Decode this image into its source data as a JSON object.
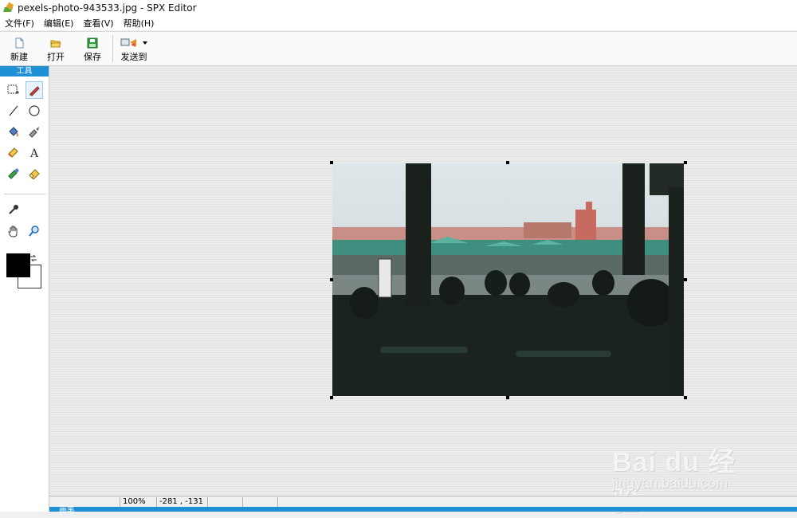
{
  "window": {
    "title": "pexels-photo-943533.jpg - SPX Editor"
  },
  "menu": {
    "items": [
      "文件(F)",
      "编辑(E)",
      "查看(V)",
      "帮助(H)"
    ]
  },
  "toolbar": {
    "new_label": "新建",
    "open_label": "打开",
    "save_label": "保存",
    "send_label": "发送到"
  },
  "palette": {
    "header": "工具",
    "tools": [
      "rect-select-icon",
      "pencil-icon",
      "line-icon",
      "ellipse-icon",
      "fill-bucket-icon",
      "brush-icon",
      "color-picker-icon",
      "text-icon",
      "highlighter-icon",
      "eraser-icon",
      "pipette-icon",
      "hand-icon",
      "zoom-icon"
    ],
    "foreground_color": "#000000",
    "background_color": "#ffffff"
  },
  "canvas": {
    "image_name": "pexels-photo-943533.jpg"
  },
  "status": {
    "zoom": "100%",
    "coords": "-281 , -131",
    "bottom_label": "画笔"
  },
  "watermark": {
    "brand": "Bai du 经验",
    "url": "jingyan.baidu.com"
  },
  "colors": {
    "accent": "#1e90d6"
  }
}
